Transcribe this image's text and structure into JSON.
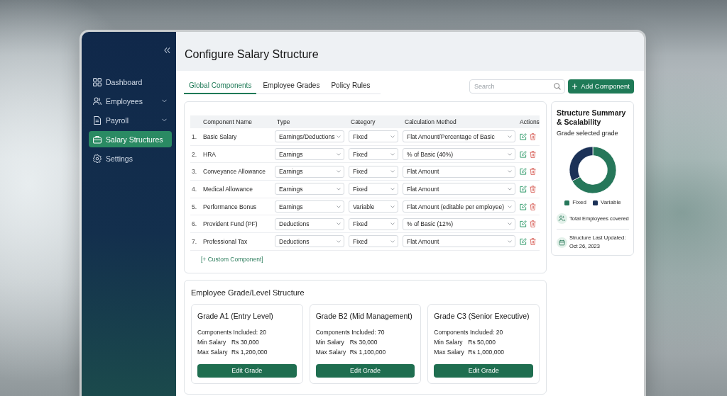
{
  "sidebar": {
    "items": [
      {
        "label": "Dashboard",
        "selected": false,
        "expandable": false
      },
      {
        "label": "Employees",
        "selected": false,
        "expandable": true
      },
      {
        "label": "Payroll",
        "selected": false,
        "expandable": true
      },
      {
        "label": "Salary Structures",
        "selected": true,
        "expandable": false
      },
      {
        "label": "Settings",
        "selected": false,
        "expandable": false
      }
    ]
  },
  "header": {
    "title": "Configure Salary Structure"
  },
  "tabs": [
    {
      "label": "Global Components",
      "selected": true
    },
    {
      "label": "Employee Grades",
      "selected": false
    },
    {
      "label": "Policy Rules",
      "selected": false
    }
  ],
  "toolbar": {
    "search": {
      "placeholder": "Search"
    },
    "add_button": "Add Component"
  },
  "components_table": {
    "columns": [
      "Component Name",
      "Type",
      "Category",
      "Calculation Method",
      "Actions"
    ],
    "rows": [
      {
        "number": "1.",
        "name": "Basic Salary",
        "type": "Earnings/Deductions",
        "category": "Fixed",
        "calculation_method": "Flat Amount/Percentage of Basic"
      },
      {
        "number": "2.",
        "name": "HRA",
        "type": "Earnings",
        "category": "Fixed",
        "calculation_method": "% of Basic (40%)"
      },
      {
        "number": "3.",
        "name": "Conveyance Allowance",
        "type": "Earnings",
        "category": "Fixed",
        "calculation_method": "Flat Amount"
      },
      {
        "number": "4.",
        "name": "Medical Allowance",
        "type": "Earnings",
        "category": "Fixed",
        "calculation_method": "Flat Amount"
      },
      {
        "number": "5.",
        "name": "Performance Bonus",
        "type": "Earnings",
        "category": "Variable",
        "calculation_method": "Flat Amount (editable per employee)"
      },
      {
        "number": "6.",
        "name": "Provident Fund (PF)",
        "type": "Deductions",
        "category": "Fixed",
        "calculation_method": "% of Basic (12%)"
      },
      {
        "number": "7.",
        "name": "Professional Tax",
        "type": "Deductions",
        "category": "Fixed",
        "calculation_method": "Flat Amount"
      }
    ],
    "add_link": "[+ Custom Component]"
  },
  "summary": {
    "title": "Structure Summary & Scalability",
    "subtitle": "Grade selected grade",
    "legend": [
      {
        "label": "Fixed",
        "color": "#26775a"
      },
      {
        "label": "Variable",
        "color": "#1b3157"
      }
    ],
    "stats": [
      {
        "label": "Total Employees covered"
      },
      {
        "label": "Structure Last Updated:",
        "value": "Oct 26, 2023"
      }
    ]
  },
  "grades": {
    "title": "Employee Grade/Level Structure",
    "cards": [
      {
        "title": "Grade A1 (Entry Level)",
        "components": "Components Included: 20",
        "fields": [
          {
            "label": "Min Salary",
            "value": "Rs 30,000"
          },
          {
            "label": "Max Salary",
            "value": "Rs 1,200,000"
          }
        ],
        "button": "Edit Grade"
      },
      {
        "title": "Grade B2 (Mid Management)",
        "components": "Components Included: 70",
        "fields": [
          {
            "label": "Min Salary",
            "value": "Rs 30,000"
          },
          {
            "label": "Max Salary",
            "value": "Rs 1,100,000"
          }
        ],
        "button": "Edit Grade"
      },
      {
        "title": "Grade C3 (Senior Executive)",
        "components": "Components Included: 20",
        "fields": [
          {
            "label": "Min Salary",
            "value": "Rs 50,000"
          },
          {
            "label": "Max Salary",
            "value": "Rs 1,000,000"
          }
        ],
        "button": "Edit Grade"
      }
    ]
  }
}
